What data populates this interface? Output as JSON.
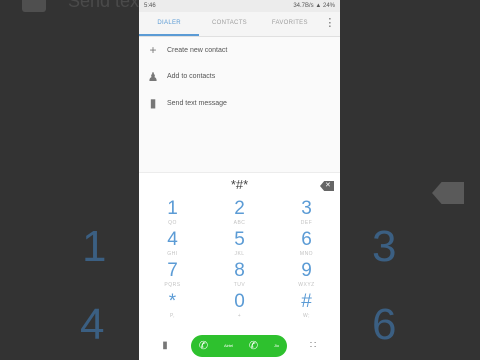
{
  "status": {
    "time": "5:46",
    "speed": "34.7B/s",
    "battery": "24%"
  },
  "tabs": [
    "DIALER",
    "CONTACTS",
    "FAVORITES"
  ],
  "actions": [
    {
      "icon": "plus-icon",
      "label": "Create new contact"
    },
    {
      "icon": "person-add-icon",
      "label": "Add to contacts"
    },
    {
      "icon": "message-icon",
      "label": "Send text message"
    }
  ],
  "dial": {
    "digits": "*#*"
  },
  "keys": [
    [
      {
        "n": "1",
        "l": "QO"
      },
      {
        "n": "2",
        "l": "ABC"
      },
      {
        "n": "3",
        "l": "DEF"
      }
    ],
    [
      {
        "n": "4",
        "l": "GHI"
      },
      {
        "n": "5",
        "l": "JKL"
      },
      {
        "n": "6",
        "l": "MNO"
      }
    ],
    [
      {
        "n": "7",
        "l": "PQRS"
      },
      {
        "n": "8",
        "l": "TUV"
      },
      {
        "n": "9",
        "l": "WXYZ"
      }
    ],
    [
      {
        "n": "*",
        "l": "P,"
      },
      {
        "n": "0",
        "l": "+"
      },
      {
        "n": "#",
        "l": "W;"
      }
    ]
  ],
  "call": {
    "sim1": "Airtel",
    "sim2": "Jio"
  },
  "background": {
    "title": "Send text",
    "nums": [
      "1",
      "3",
      "4",
      "6"
    ]
  },
  "colors": {
    "accent": "#5b9bd5",
    "call": "#2ec12e"
  }
}
